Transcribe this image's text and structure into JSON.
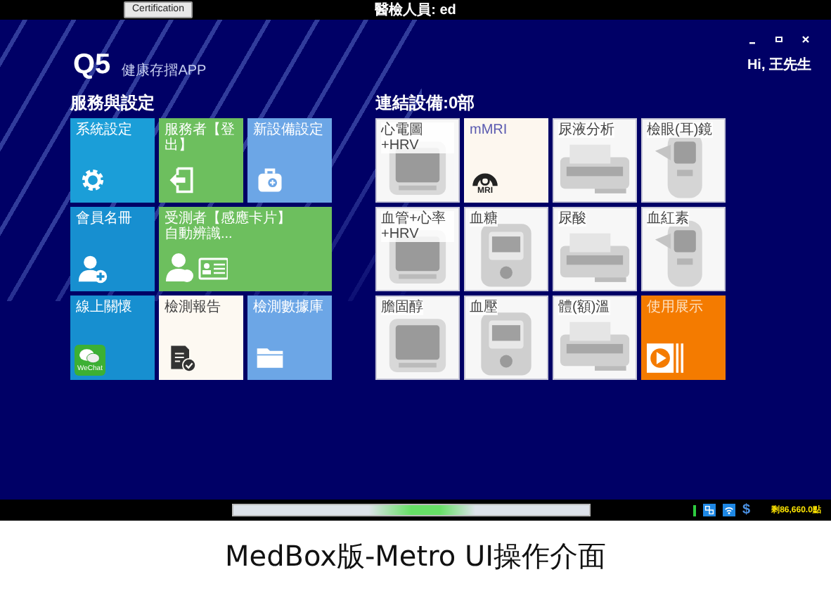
{
  "top_bar": {
    "button": "Certification",
    "title": "醫檢人員: ed"
  },
  "app": {
    "logo": "Q5",
    "subtitle": "健康存摺APP",
    "greeting": "Hi, 王先生"
  },
  "services": {
    "title": "服務與設定",
    "tiles": [
      {
        "kind": "square",
        "label": "系統設定",
        "color": "#1b9ed8"
      },
      {
        "kind": "square",
        "label": "服務者【登出】",
        "color": "#6dbf5e"
      },
      {
        "kind": "square",
        "label": "新設備設定",
        "color": "#6ca6e6"
      },
      {
        "kind": "square",
        "label": "會員名冊",
        "color": "#178fd0"
      },
      {
        "kind": "wide",
        "label": "受測者【感應卡片】",
        "note": "自動辨識...",
        "color": "#6dbf5e"
      },
      {
        "kind": "square",
        "label": "線上關懷",
        "color": "#178fd0",
        "badge": "WeChat"
      },
      {
        "kind": "square",
        "label": "檢測報告",
        "color": "#fdf9f2"
      },
      {
        "kind": "square",
        "label": "檢測數據庫",
        "color": "#6ca6e6"
      }
    ]
  },
  "devices": {
    "title": "連結設備:0部",
    "tiles": [
      {
        "kind": "device",
        "label": "心電圖+HRV"
      },
      {
        "kind": "mri",
        "label": "mMRI",
        "badge": "MRI"
      },
      {
        "kind": "device",
        "label": "尿液分析"
      },
      {
        "kind": "device",
        "label": "檢眼(耳)鏡"
      },
      {
        "kind": "device",
        "label": "血管+心率+HRV"
      },
      {
        "kind": "device",
        "label": "血糖"
      },
      {
        "kind": "device",
        "label": "尿酸"
      },
      {
        "kind": "device",
        "label": "血紅素"
      },
      {
        "kind": "device",
        "label": "膽固醇"
      },
      {
        "kind": "device",
        "label": "血壓"
      },
      {
        "kind": "device",
        "label": "體(額)溫"
      },
      {
        "kind": "demo",
        "label": "使用展示"
      }
    ]
  },
  "status_bar": {
    "currency": "$",
    "balance": "剩86,660.0點"
  },
  "caption": "MedBox版-Metro UI操作介面"
}
